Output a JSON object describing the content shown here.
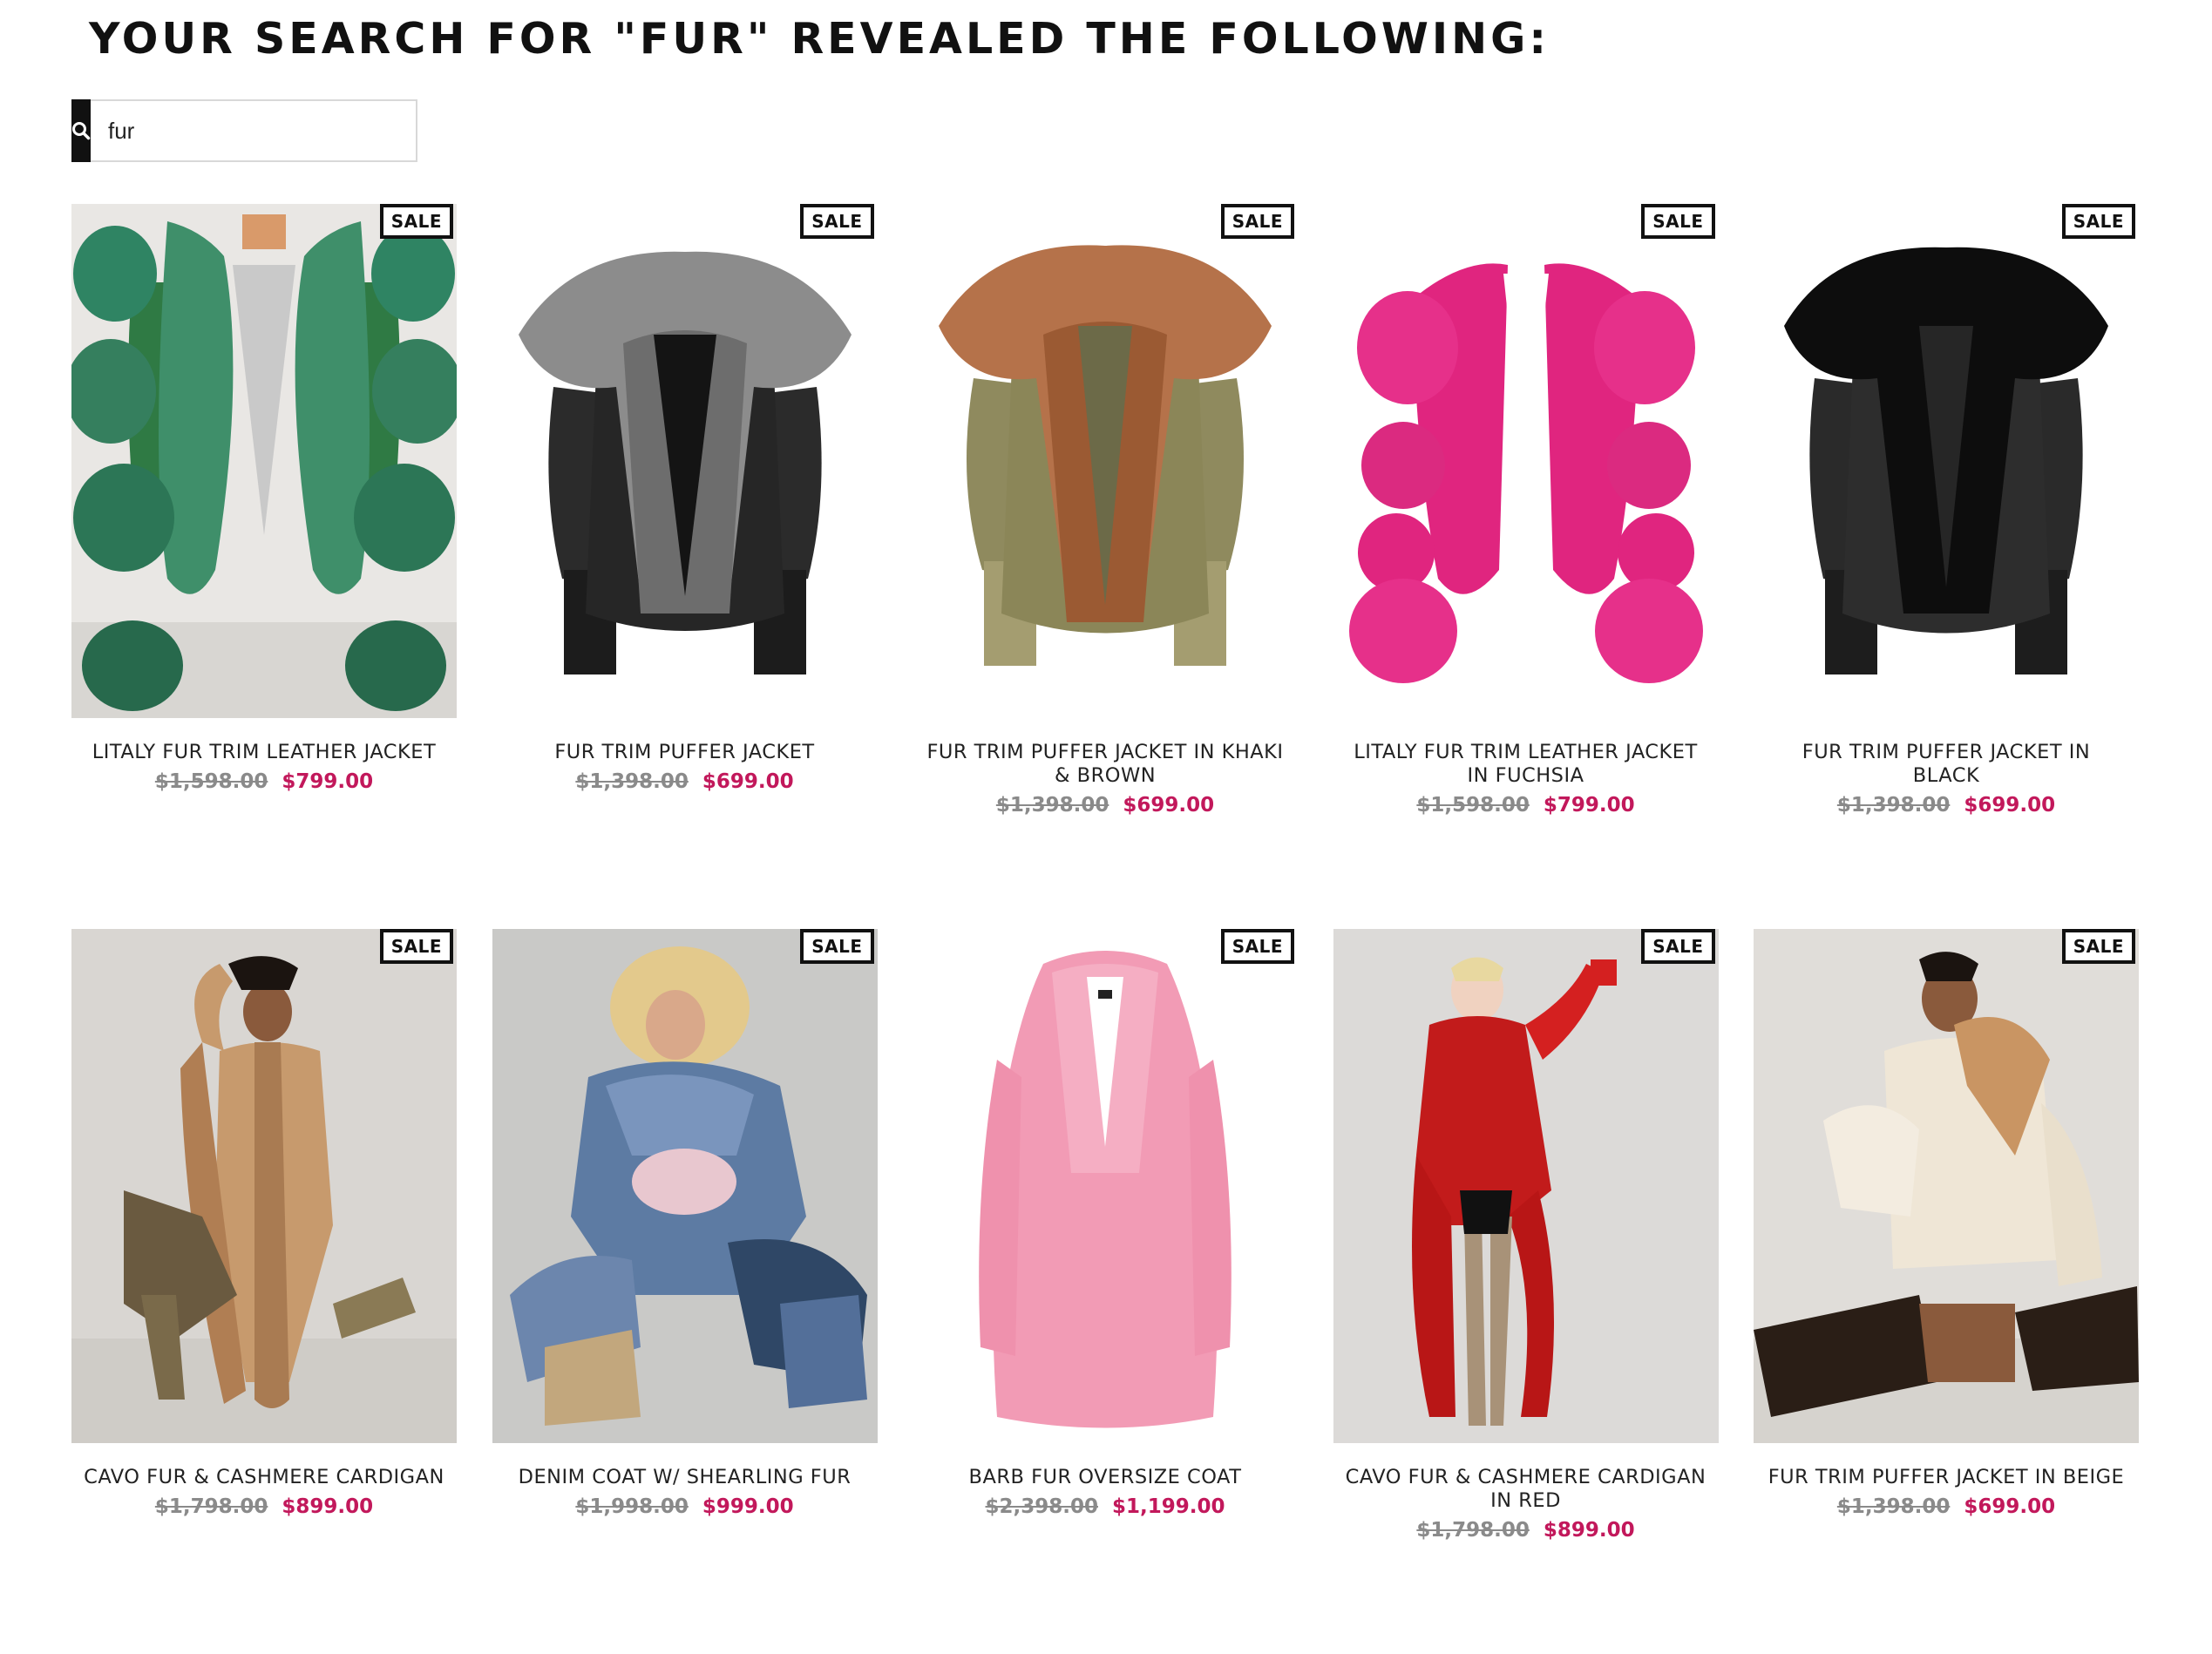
{
  "page": {
    "title": "YOUR SEARCH FOR \"FUR\" REVEALED THE FOLLOWING:"
  },
  "search": {
    "value": "fur",
    "icon": "search-icon"
  },
  "colors": {
    "sale_price": "#c2185b",
    "original_price": "#8a8a8a",
    "badge_border": "#111111",
    "search_button": "#111111"
  },
  "products": [
    {
      "name": "LITALY FUR TRIM LEATHER JACKET",
      "badge": "SALE",
      "original_price": "$1,598.00",
      "sale_price": "$799.00",
      "image": "green-fur-leather-jacket"
    },
    {
      "name": "FUR TRIM PUFFER JACKET",
      "badge": "SALE",
      "original_price": "$1,398.00",
      "sale_price": "$699.00",
      "image": "black-puffer-silver-fur"
    },
    {
      "name": "FUR TRIM PUFFER JACKET IN KHAKI & BROWN",
      "badge": "SALE",
      "original_price": "$1,398.00",
      "sale_price": "$699.00",
      "image": "khaki-puffer-brown-fur"
    },
    {
      "name": "LITALY FUR TRIM LEATHER JACKET IN FUCHSIA",
      "badge": "SALE",
      "original_price": "$1,598.00",
      "sale_price": "$799.00",
      "image": "fuchsia-fur-jacket"
    },
    {
      "name": "FUR TRIM PUFFER JACKET IN BLACK",
      "badge": "SALE",
      "original_price": "$1,398.00",
      "sale_price": "$699.00",
      "image": "black-puffer-black-fur"
    },
    {
      "name": "CAVO FUR & CASHMERE CARDIGAN",
      "badge": "SALE",
      "original_price": "$1,798.00",
      "sale_price": "$899.00",
      "image": "camel-fur-cardigan-model"
    },
    {
      "name": "DENIM COAT W/ SHEARLING FUR",
      "badge": "SALE",
      "original_price": "$1,998.00",
      "sale_price": "$999.00",
      "image": "denim-shearling-coat-model"
    },
    {
      "name": "BARB FUR OVERSIZE COAT",
      "badge": "SALE",
      "original_price": "$2,398.00",
      "sale_price": "$1,199.00",
      "image": "pink-fur-coat"
    },
    {
      "name": "CAVO FUR & CASHMERE CARDIGAN IN RED",
      "badge": "SALE",
      "original_price": "$1,798.00",
      "sale_price": "$899.00",
      "image": "red-fur-cardigan-model"
    },
    {
      "name": "FUR TRIM PUFFER JACKET IN BEIGE",
      "badge": "SALE",
      "original_price": "$1,398.00",
      "sale_price": "$699.00",
      "image": "beige-puffer-model"
    }
  ]
}
